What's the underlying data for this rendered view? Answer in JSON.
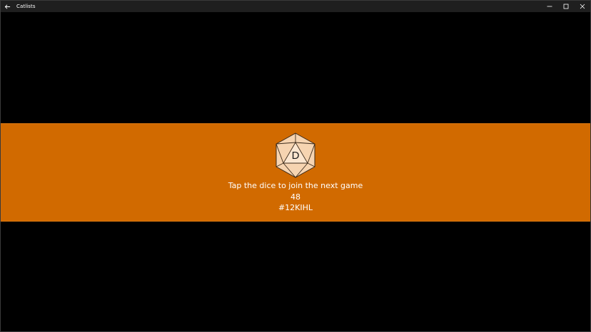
{
  "window": {
    "title": "Catlists"
  },
  "banner": {
    "dice_letter": "D",
    "instruction": "Tap the dice to join the next game",
    "count": "48",
    "game_code": "#12KIHL"
  },
  "colors": {
    "banner": "#d16a00",
    "dice_fill": "#f6d4b1",
    "background": "#000000",
    "titlebar": "#1f1f1f"
  },
  "icons": {
    "back": "back-arrow-icon",
    "minimize": "minimize-icon",
    "maximize": "maximize-icon",
    "close": "close-icon",
    "dice": "d20-dice-icon"
  }
}
